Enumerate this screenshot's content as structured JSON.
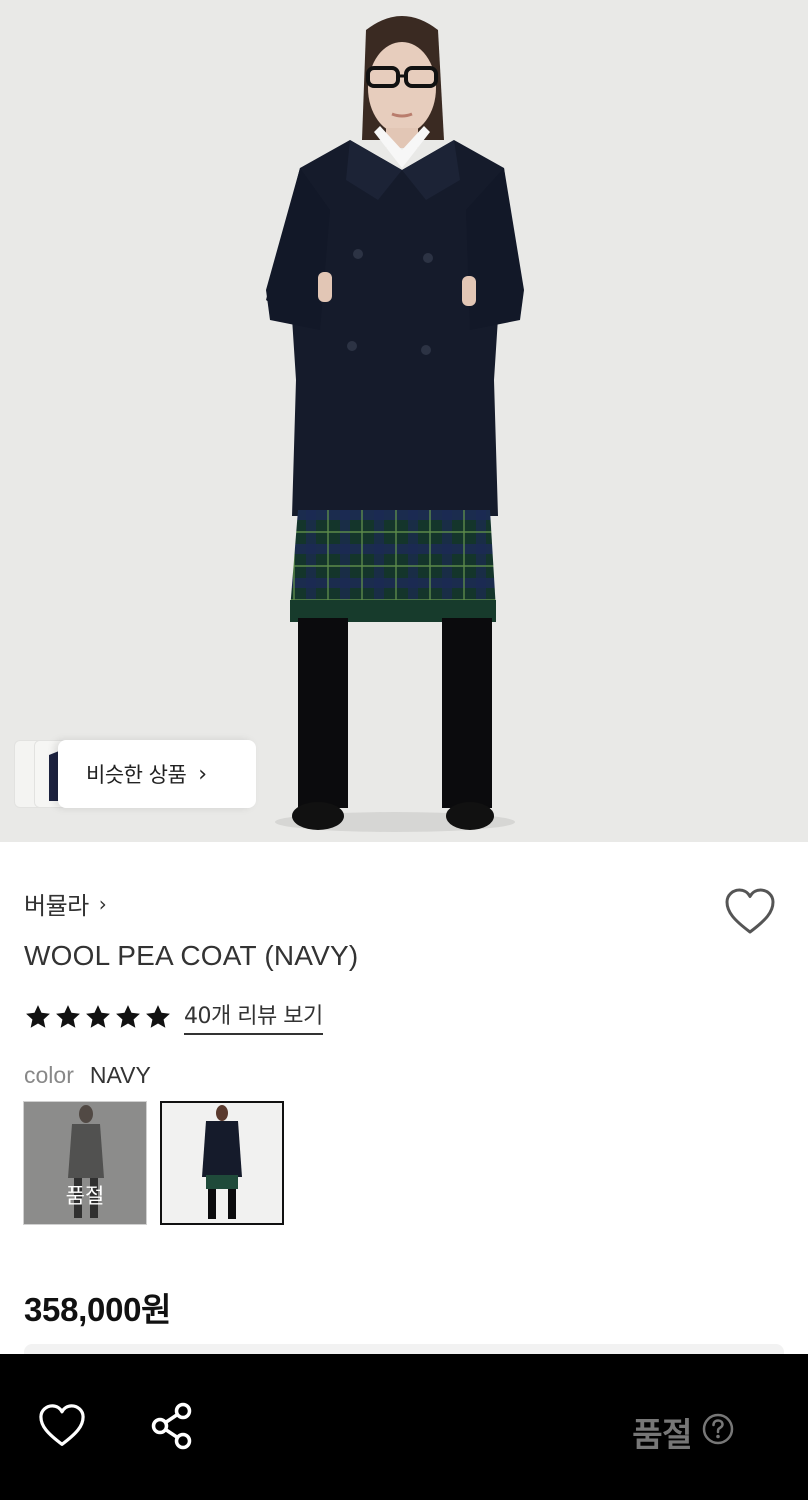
{
  "similar_products": {
    "label": "비슷한 상품",
    "chevron": "›",
    "icon": "chevron-right-icon"
  },
  "product": {
    "brand": "버뮬라",
    "brand_chevron": "›",
    "title": "WOOL PEA COAT (NAVY)",
    "rating_stars": 5,
    "review_link": "40개 리뷰 보기",
    "color_label": "color",
    "color_value": "NAVY",
    "swatches": [
      {
        "name": "gray-variant",
        "sold_out": true,
        "sold_out_label": "품절"
      },
      {
        "name": "navy-variant",
        "sold_out": false,
        "selected": true
      }
    ],
    "price": "358,000원"
  },
  "bottom_bar": {
    "like_icon": "heart-outline-icon",
    "share_icon": "share-icon",
    "status_label": "품절",
    "help_icon": "question-circle-icon"
  },
  "colors": {
    "background": "#ffffff",
    "hero_bg": "#e9e9e7",
    "coat": "#151b2b",
    "bottom_bar": "#000000",
    "sold_out_text": "#777777"
  }
}
